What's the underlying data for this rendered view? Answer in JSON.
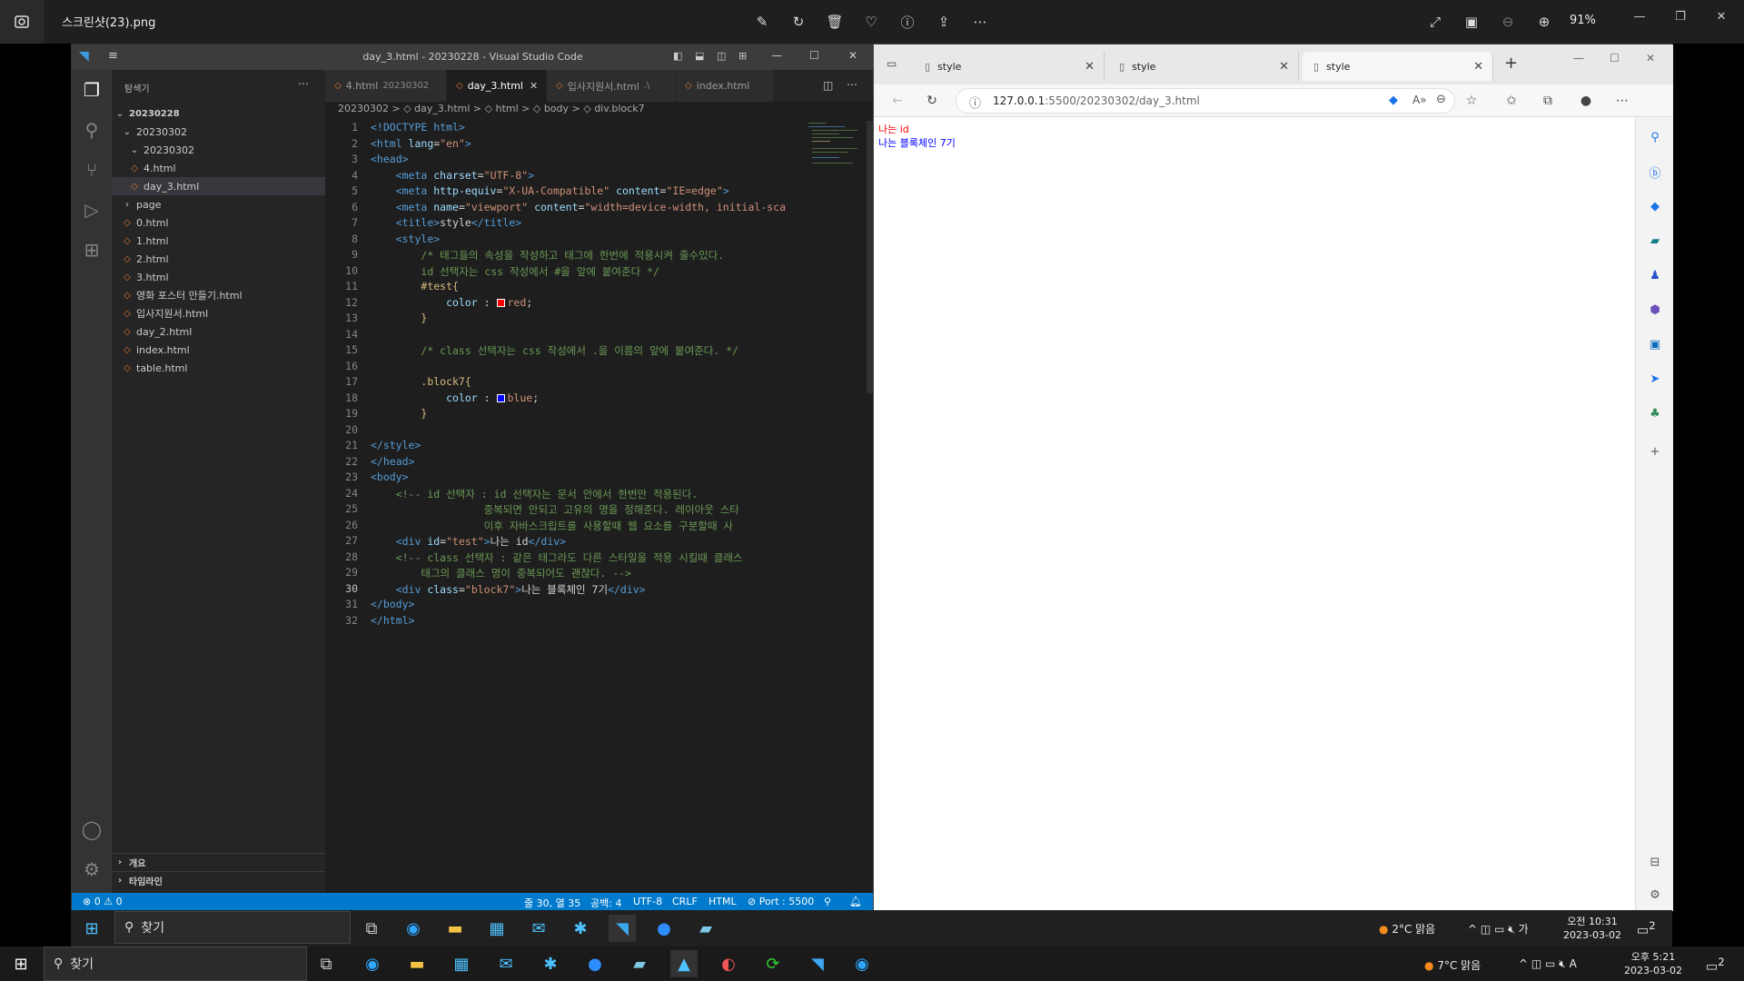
{
  "viewer": {
    "title": "스크린샷(23).png",
    "zoom": "91%"
  },
  "vscode": {
    "window_title": "day_3.html - 20230228 - Visual Studio Code",
    "explorer_title": "탐색기",
    "tree": [
      {
        "label": "20230228",
        "type": "folder"
      },
      {
        "label": "20230302",
        "type": "folder"
      },
      {
        "label": "20230302",
        "type": "folder"
      },
      {
        "label": "4.html",
        "type": "file"
      },
      {
        "label": "day_3.html",
        "type": "file"
      },
      {
        "label": "page",
        "type": "folder"
      },
      {
        "label": "0.html",
        "type": "file"
      },
      {
        "label": "1.html",
        "type": "file"
      },
      {
        "label": "2.html",
        "type": "file"
      },
      {
        "label": "3.html",
        "type": "file"
      },
      {
        "label": "영화 포스터 만들기.html",
        "type": "file"
      },
      {
        "label": "입사지원서.html",
        "type": "file"
      },
      {
        "label": "day_2.html",
        "type": "file"
      },
      {
        "label": "index.html",
        "type": "file"
      },
      {
        "label": "table.html",
        "type": "file"
      }
    ],
    "outline": "개요",
    "timeline": "타임라인",
    "tabs": [
      {
        "label": "4.html",
        "dim": "20230302"
      },
      {
        "label": "day_3.html",
        "dim": ""
      },
      {
        "label": "입사지원서.html",
        "dim": ".\\"
      },
      {
        "label": "index.html",
        "dim": ""
      }
    ],
    "breadcrumb": "20230302 > ◇ day_3.html > ◇ html > ◇ body > ◇ div.block7",
    "status": {
      "problems": "⊗ 0 ⚠ 0",
      "position": "줄 30, 열 35",
      "spaces": "공백: 4",
      "encoding": "UTF-8",
      "eol": "CRLF",
      "language": "HTML",
      "port": "⊘ Port : 5500"
    },
    "code": {
      "l1a": "<!DOCTYPE html>",
      "l2a": "<html ",
      "l2b": "lang",
      "l2c": "=",
      "l2d": "\"en\"",
      "l2e": ">",
      "l3": "<head>",
      "l4a": "<meta ",
      "l4b": "charset",
      "l4c": "=",
      "l4d": "\"UTF-8\"",
      "l4e": ">",
      "l5a": "<meta ",
      "l5b": "http-equiv",
      "l5c": "=",
      "l5d": "\"X-UA-Compatible\"",
      "l5e": " content",
      "l5f": "=",
      "l5g": "\"IE=edge\"",
      "l5h": ">",
      "l6a": "<meta ",
      "l6b": "name",
      "l6c": "=",
      "l6d": "\"viewport\"",
      "l6e": " content",
      "l6f": "=",
      "l6g": "\"width=device-width, initial-sca",
      "l7a": "<title>",
      "l7b": "style",
      "l7c": "</title>",
      "l8": "<style>",
      "l9": "/* 태그들의 속성을 작성하고 태그에 한번에 적용시켜 줄수있다.",
      "l10": "id 선택자는 css 작성에서 #을 앞에 붙여준다 */",
      "l11": "#test{",
      "l12a": "color",
      "l12b": " : ",
      "l12c": "red",
      "l12d": ";",
      "l13": "}",
      "l15": "/* class 선택자는 css 작성에서 .을 이름의 앞에 붙여준다. */",
      "l17": ".block7{",
      "l18a": "color",
      "l18b": " : ",
      "l18c": "blue",
      "l18d": ";",
      "l19": "}",
      "l21": "</style>",
      "l22": "</head>",
      "l23": "<body>",
      "l24": "<!-- id 선택자 : id 선택자는 문서 안에서 한번만 적용된다.",
      "l25": "              중복되면 안되고 고유의 명을 정해준다. 레이아웃 스타",
      "l26": "              이후 자바스크립트를 사용할때 웹 요소를 구분할때 사",
      "l27a": "<div ",
      "l27b": "id",
      "l27c": "=",
      "l27d": "\"test\"",
      "l27e": ">",
      "l27f": "나는 id",
      "l27g": "</div>",
      "l28": "<!-- class 선택자 : 같은 태그라도 다른 스타일을 적용 시킬때 클래스",
      "l29": "태그의 클래스 명이 중복되어도 괜찮다. -->",
      "l30a": "<div ",
      "l30b": "class",
      "l30c": "=",
      "l30d": "\"block7\"",
      "l30e": ">",
      "l30f": "나는 블록체인 7기",
      "l30g": "</div>",
      "l31": "</body>",
      "l32": "</html>"
    }
  },
  "browser": {
    "tabs": [
      {
        "label": "style"
      },
      {
        "label": "style"
      },
      {
        "label": "style"
      }
    ],
    "url_host": "127.0.0.1",
    "url_path": ":5500/20230302/day_3.html",
    "page": {
      "text_red": "나는 id",
      "text_blue": "나는 블록체인 7기"
    }
  },
  "inner_taskbar": {
    "search": "찾기",
    "weather": "2°C  맑음",
    "ime": "가",
    "time": "오전 10:31",
    "date": "2023-03-02",
    "notif": "2"
  },
  "taskbar": {
    "search": "찾기",
    "weather": "7°C  맑음",
    "ime": "A",
    "time": "오후 5:21",
    "date": "2023-03-02",
    "notif": "2"
  },
  "colors": {
    "vs_blue": "#007acc",
    "red": "#ff0000",
    "blue": "#0000ff"
  }
}
